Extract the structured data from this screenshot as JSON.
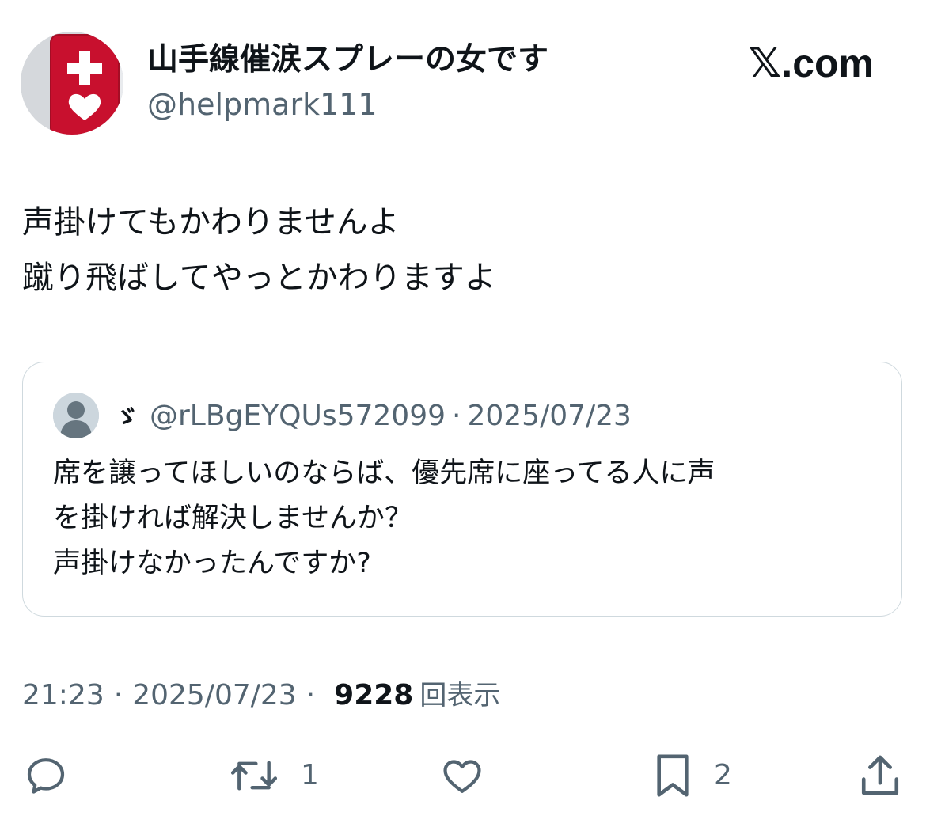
{
  "author": {
    "display_name": "山手線催涙スプレーの女です",
    "handle": "@helpmark111"
  },
  "brand": {
    "x_mark": "𝕏",
    "domain_text": ".com"
  },
  "tweet": {
    "lines": [
      "声掛けてもかわりませんよ",
      "蹴り飛ばしてやっとかわりますよ"
    ]
  },
  "quote": {
    "name": "ゞ",
    "handle": "@rLBgEYQUs572099",
    "separator": "·",
    "date": "2025/07/23",
    "lines": [
      "席を譲ってほしいのならば、優先席に座ってる人に声",
      "を掛ければ解決しませんか？",
      "声掛けなかったんですか?"
    ]
  },
  "meta": {
    "time": "21:23",
    "separator": "·",
    "date": "2025/07/23",
    "views": "9228",
    "views_label": "回表示"
  },
  "actions": {
    "reply_count": "",
    "retweet_count": "1",
    "like_count": "",
    "bookmark_count": "2"
  },
  "colors": {
    "text": "#0f1419",
    "muted": "#536471",
    "border": "#cfd9de",
    "avatar_red": "#c8102e"
  },
  "icons": [
    "reply-icon",
    "retweet-icon",
    "like-icon",
    "bookmark-icon",
    "share-icon",
    "x-logo-icon"
  ]
}
